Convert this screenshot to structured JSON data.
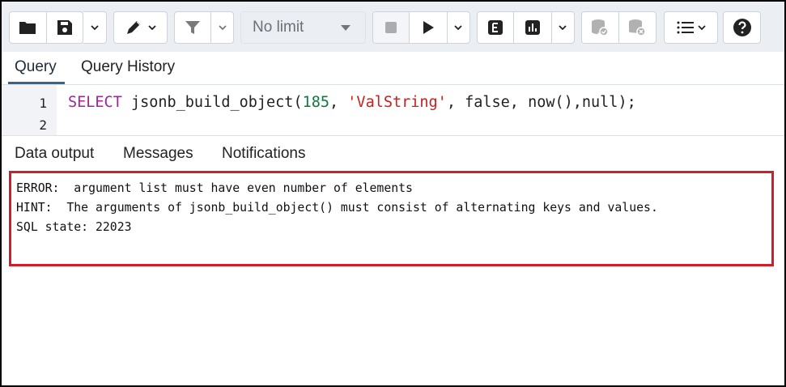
{
  "toolbar": {
    "limit_label": "No limit",
    "icons": [
      "folder-icon",
      "save-icon",
      "edit-icon",
      "filter-icon",
      "stop-icon",
      "play-icon",
      "explain-icon",
      "explain-analyze-icon",
      "commit-icon",
      "rollback-icon",
      "macros-icon",
      "help-icon"
    ],
    "colors": {
      "bar": "#ebeef3",
      "border": "#cdd3dc",
      "icon": "#222222"
    }
  },
  "editor_tabs": {
    "query": "Query",
    "history": "Query History"
  },
  "editor": {
    "line_numbers": [
      "1",
      "2"
    ],
    "code": {
      "select": "SELECT",
      "func": " jsonb_build_object(",
      "num": "185",
      "comma1": ", ",
      "str": "'ValString'",
      "rest": ", false, now(),null);"
    }
  },
  "output_tabs": {
    "data_output": "Data output",
    "messages": "Messages",
    "notifications": "Notifications"
  },
  "messages": {
    "error": "ERROR:  argument list must have even number of elements",
    "hint": "HINT:  The arguments of jsonb_build_object() must consist of alternating keys and values.",
    "state": "SQL state: 22023"
  }
}
